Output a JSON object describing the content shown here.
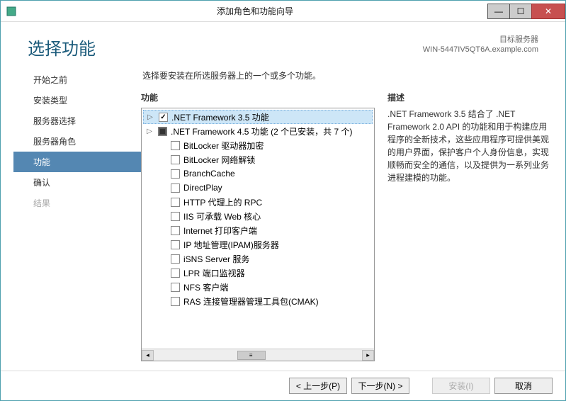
{
  "window": {
    "title": "添加角色和功能向导"
  },
  "header": {
    "page_title": "选择功能",
    "target_label": "目标服务器",
    "target_value": "WIN-5447IV5QT6A.example.com"
  },
  "sidebar": {
    "items": [
      {
        "label": "开始之前",
        "state": "normal"
      },
      {
        "label": "安装类型",
        "state": "normal"
      },
      {
        "label": "服务器选择",
        "state": "normal"
      },
      {
        "label": "服务器角色",
        "state": "normal"
      },
      {
        "label": "功能",
        "state": "selected"
      },
      {
        "label": "确认",
        "state": "normal"
      },
      {
        "label": "结果",
        "state": "disabled"
      }
    ]
  },
  "content": {
    "instruction": "选择要安装在所选服务器上的一个或多个功能。",
    "features_label": "功能",
    "description_label": "描述",
    "description_text": ".NET Framework 3.5 结合了 .NET Framework 2.0 API 的功能和用于构建应用程序的全新技术，这些应用程序可提供美观的用户界面，保护客户个人身份信息，实现顺畅而安全的通信，以及提供为一系列业务进程建模的功能。"
  },
  "features": [
    {
      "expand": "▷",
      "check": "checked",
      "label": ".NET Framework 3.5 功能",
      "selected": true,
      "indent": 0
    },
    {
      "expand": "▷",
      "check": "partial",
      "label": ".NET Framework 4.5 功能 (2 个已安装，共 7 个)",
      "indent": 0
    },
    {
      "expand": "",
      "check": "",
      "label": "BitLocker 驱动器加密",
      "indent": 1
    },
    {
      "expand": "",
      "check": "",
      "label": "BitLocker 网络解锁",
      "indent": 1
    },
    {
      "expand": "",
      "check": "",
      "label": "BranchCache",
      "indent": 1
    },
    {
      "expand": "",
      "check": "",
      "label": "DirectPlay",
      "indent": 1
    },
    {
      "expand": "",
      "check": "",
      "label": "HTTP 代理上的 RPC",
      "indent": 1
    },
    {
      "expand": "",
      "check": "",
      "label": "IIS 可承载 Web 核心",
      "indent": 1
    },
    {
      "expand": "",
      "check": "",
      "label": "Internet 打印客户端",
      "indent": 1
    },
    {
      "expand": "",
      "check": "",
      "label": "IP 地址管理(IPAM)服务器",
      "indent": 1
    },
    {
      "expand": "",
      "check": "",
      "label": "iSNS Server 服务",
      "indent": 1
    },
    {
      "expand": "",
      "check": "",
      "label": "LPR 端口监视器",
      "indent": 1
    },
    {
      "expand": "",
      "check": "",
      "label": "NFS 客户端",
      "indent": 1
    },
    {
      "expand": "",
      "check": "",
      "label": "RAS 连接管理器管理工具包(CMAK)",
      "indent": 1
    }
  ],
  "footer": {
    "prev": "< 上一步(P)",
    "next": "下一步(N) >",
    "install": "安装(I)",
    "cancel": "取消"
  }
}
